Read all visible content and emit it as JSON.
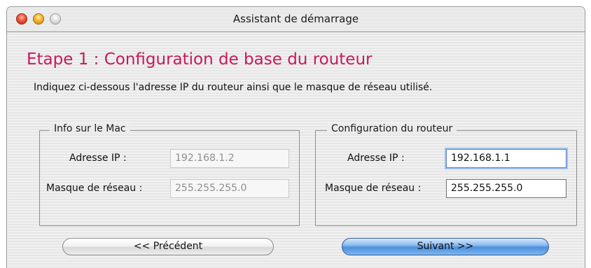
{
  "window": {
    "title": "Assistant de démarrage"
  },
  "step": {
    "title": "Etape 1 : Configuration de base du routeur",
    "instruction": "Indiquez ci-dessous l'adresse IP du routeur ainsi que le masque de réseau utilisé."
  },
  "mac_group": {
    "legend": "Info sur le Mac",
    "ip_label": "Adresse IP :",
    "ip_value": "192.168.1.2",
    "mask_label": "Masque de réseau :",
    "mask_value": "255.255.255.0"
  },
  "router_group": {
    "legend": "Configuration du routeur",
    "ip_label": "Adresse IP :",
    "ip_value": "192.168.1.1",
    "mask_label": "Masque de réseau :",
    "mask_value": "255.255.255.0"
  },
  "buttons": {
    "previous": "<< Précédent",
    "next": "Suivant >>"
  },
  "colors": {
    "step_title": "#c8185c",
    "default_button": "#4d90de",
    "focus_ring": "#9fc0ee"
  }
}
